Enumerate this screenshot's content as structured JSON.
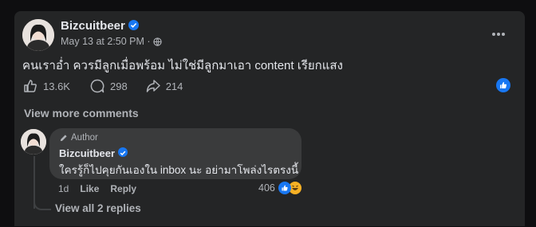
{
  "post": {
    "author": "Bizcuitbeer",
    "timestamp": "May 13 at 2:50 PM",
    "separator": "·",
    "text": "คนเราอ่ำ ควรมีลูกเมื่อพร้อม ไม่ใช่มีลูกมาเอา content เรียกแสง",
    "likes": "13.6K",
    "comments": "298",
    "shares": "214",
    "privacy_icon": "globe-icon",
    "more_icon": "more-dots-icon"
  },
  "comments_section": {
    "view_more": "View more comments"
  },
  "comment": {
    "author_badge": "Author",
    "author": "Bizcuitbeer",
    "text": "ใครรู้ก็ไปคุยกันเองใน inbox นะ อย่ามาโพล่งไรตรงนี้",
    "time": "1d",
    "like_label": "Like",
    "reply_label": "Reply",
    "reaction_count": "406",
    "view_replies": "View all 2 replies"
  },
  "colors": {
    "accent": "#1877f2",
    "card_bg": "#242526",
    "bubble_bg": "#3a3b3c"
  }
}
